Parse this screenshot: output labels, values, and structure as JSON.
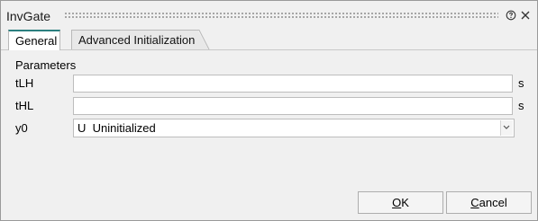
{
  "window": {
    "title": "InvGate"
  },
  "icons": {
    "help": "help-icon",
    "close": "close-icon",
    "dropdown": "chevron-down-icon"
  },
  "tabs": [
    {
      "label": "General",
      "active": true
    },
    {
      "label": "Advanced Initialization",
      "active": false
    }
  ],
  "general": {
    "section_label": "Parameters",
    "params": [
      {
        "label": "tLH",
        "value": "",
        "unit": "s"
      },
      {
        "label": "tHL",
        "value": "",
        "unit": "s"
      }
    ],
    "y0": {
      "label": "y0",
      "selected": "U  Uninitialized"
    }
  },
  "buttons": {
    "ok_mnemonic": "O",
    "ok_rest": "K",
    "cancel_mnemonic": "C",
    "cancel_rest": "ancel"
  },
  "colors": {
    "active_tab_accent": "#2b7f7f",
    "dialog_background": "#f0f0f0"
  }
}
